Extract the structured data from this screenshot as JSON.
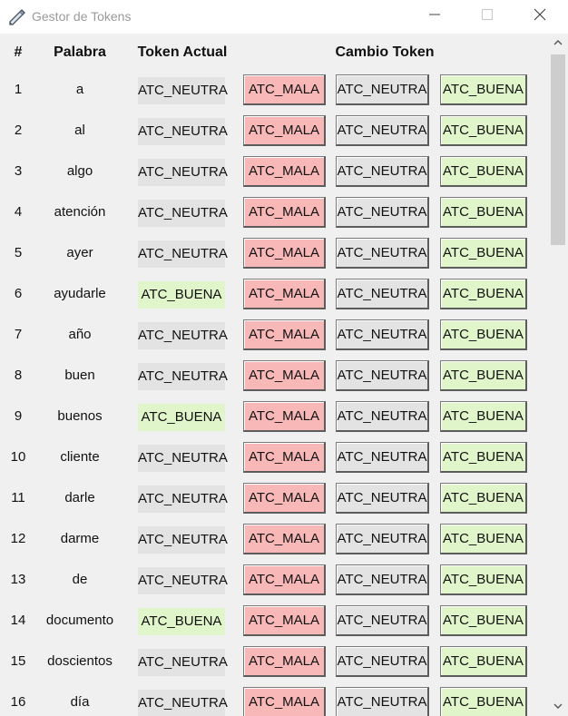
{
  "window": {
    "title": "Gestor de Tokens"
  },
  "header": {
    "num": "#",
    "word": "Palabra",
    "current": "Token Actual",
    "change": "Cambio Token"
  },
  "colors": {
    "mala": "#f9b8b8",
    "neutra": "#e3e3e3",
    "buena": "#e0f5c9"
  },
  "buttons": {
    "mala": "ATC_MALA",
    "neutra": "ATC_NEUTRA",
    "buena": "ATC_BUENA"
  },
  "rows": [
    {
      "num": "1",
      "word": "a",
      "current": "ATC_NEUTRA"
    },
    {
      "num": "2",
      "word": "al",
      "current": "ATC_NEUTRA"
    },
    {
      "num": "3",
      "word": "algo",
      "current": "ATC_NEUTRA"
    },
    {
      "num": "4",
      "word": "atención",
      "current": "ATC_NEUTRA"
    },
    {
      "num": "5",
      "word": "ayer",
      "current": "ATC_NEUTRA"
    },
    {
      "num": "6",
      "word": "ayudarle",
      "current": "ATC_BUENA"
    },
    {
      "num": "7",
      "word": "año",
      "current": "ATC_NEUTRA"
    },
    {
      "num": "8",
      "word": "buen",
      "current": "ATC_NEUTRA"
    },
    {
      "num": "9",
      "word": "buenos",
      "current": "ATC_BUENA"
    },
    {
      "num": "10",
      "word": "cliente",
      "current": "ATC_NEUTRA"
    },
    {
      "num": "11",
      "word": "darle",
      "current": "ATC_NEUTRA"
    },
    {
      "num": "12",
      "word": "darme",
      "current": "ATC_NEUTRA"
    },
    {
      "num": "13",
      "word": "de",
      "current": "ATC_NEUTRA"
    },
    {
      "num": "14",
      "word": "documento",
      "current": "ATC_BUENA"
    },
    {
      "num": "15",
      "word": "doscientos",
      "current": "ATC_NEUTRA"
    },
    {
      "num": "16",
      "word": "día",
      "current": "ATC_NEUTRA"
    }
  ]
}
